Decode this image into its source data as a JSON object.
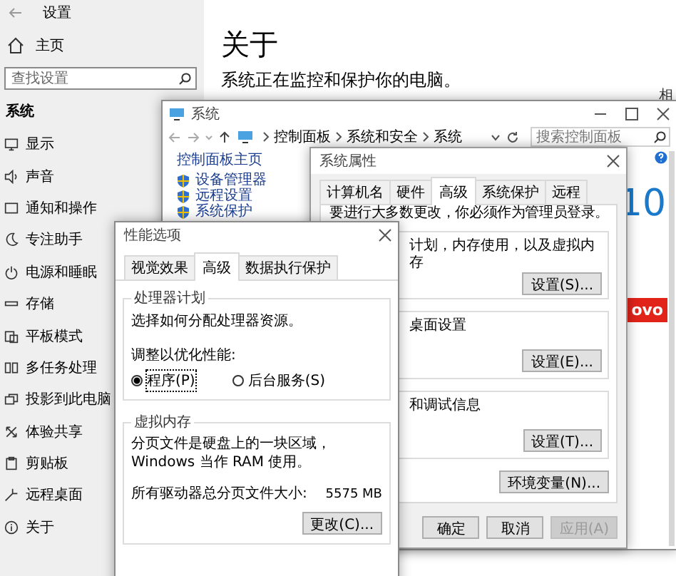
{
  "settings": {
    "title": "设置",
    "home": "主页",
    "search": {
      "placeholder": "查找设置"
    },
    "section": "系统",
    "items": [
      {
        "label": "显示"
      },
      {
        "label": "声音"
      },
      {
        "label": "通知和操作"
      },
      {
        "label": "专注助手"
      },
      {
        "label": "电源和睡眠"
      },
      {
        "label": "存储"
      },
      {
        "label": "平板模式"
      },
      {
        "label": "多任务处理"
      },
      {
        "label": "投影到此电脑"
      },
      {
        "label": "体验共享"
      },
      {
        "label": "剪贴板"
      },
      {
        "label": "远程桌面"
      },
      {
        "label": "关于"
      }
    ],
    "page": {
      "heading": "关于",
      "status": "系统正在监控和保护你的电脑。",
      "related": "相"
    }
  },
  "control_panel": {
    "title": "系统",
    "breadcrumb": [
      "控制面板",
      "系统和安全",
      "系统"
    ],
    "search": {
      "placeholder": "搜索控制面板"
    },
    "home_link": "控制面板主页",
    "links": [
      "设备管理器",
      "远程设置",
      "系统保护"
    ],
    "edition": "10",
    "brand": "ovo"
  },
  "system_properties": {
    "title": "系统属性",
    "tabs": [
      {
        "label": "计算机名",
        "selected": false
      },
      {
        "label": "硬件",
        "selected": false
      },
      {
        "label": "高级",
        "selected": true
      },
      {
        "label": "系统保护",
        "selected": false
      },
      {
        "label": "远程",
        "selected": false
      }
    ],
    "notice": "要进行大多数更改，你必须作为管理员登录。",
    "groups": [
      {
        "text": "计划，内存使用，以及虚拟内存",
        "button": "设置(S)..."
      },
      {
        "text": "桌面设置",
        "button": "设置(E)..."
      },
      {
        "text": "和调试信息",
        "button": "设置(T)..."
      }
    ],
    "env_button": "环境变量(N)...",
    "footer": [
      {
        "label": "确定",
        "disabled": false
      },
      {
        "label": "取消",
        "disabled": false
      },
      {
        "label": "应用(A)",
        "disabled": true
      }
    ]
  },
  "performance_options": {
    "title": "性能选项",
    "tabs": [
      {
        "label": "视觉效果",
        "selected": false
      },
      {
        "label": "高级",
        "selected": true
      },
      {
        "label": "数据执行保护",
        "selected": false
      }
    ],
    "processor": {
      "title": "处理器计划",
      "description": "选择如何分配处理器资源。",
      "prompt": "调整以优化性能:",
      "options": [
        {
          "label": "程序(P)",
          "selected": true
        },
        {
          "label": "后台服务(S)",
          "selected": false
        }
      ]
    },
    "virtual_memory": {
      "title": "虚拟内存",
      "description": "分页文件是硬盘上的一块区域，Windows 当作 RAM 使用。",
      "total_label": "所有驱动器总分页文件大小:",
      "total_value": "5575 MB",
      "button": "更改(C)..."
    }
  }
}
